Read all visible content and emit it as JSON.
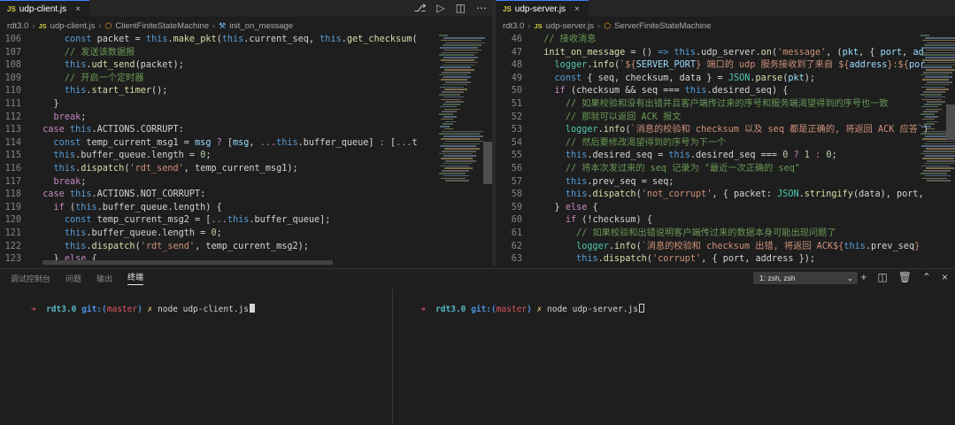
{
  "colors": {
    "keyword": "#569cd6",
    "control": "#c586c0",
    "function": "#dcdcaa",
    "variable": "#9cdcfe",
    "string": "#ce9178",
    "comment": "#6a9955",
    "number": "#b5cea8",
    "object": "#4ec9b0",
    "plain": "#d4d4d4",
    "param": "#9cdcfe"
  },
  "left_editor": {
    "tab": {
      "icon": "JS",
      "label": "udp-client.js",
      "close": "×"
    },
    "actions": [
      "source-control-icon",
      "run-icon",
      "split-editor-icon",
      "more-icon"
    ],
    "breadcrumb": {
      "folder": "rdt3.0",
      "file_icon": "JS",
      "file": "udp-client.js",
      "class": "ClientFiniteStateMachine",
      "method": "init_on_message"
    },
    "lines": [
      {
        "n": "106",
        "indent": 3,
        "tokens": [
          [
            "k",
            "const "
          ],
          [
            "p",
            "packet "
          ],
          [
            "p",
            "= "
          ],
          [
            "k",
            "this"
          ],
          [
            "p",
            "."
          ],
          [
            "f",
            "make_pkt"
          ],
          [
            "p",
            "("
          ],
          [
            "k",
            "this"
          ],
          [
            "p",
            ".current_seq, "
          ],
          [
            "k",
            "this"
          ],
          [
            "p",
            "."
          ],
          [
            "f",
            "get_checksum"
          ],
          [
            "p",
            "("
          ]
        ]
      },
      {
        "n": "107",
        "indent": 3,
        "tokens": [
          [
            "c",
            "// 发送该数据报"
          ]
        ]
      },
      {
        "n": "108",
        "indent": 3,
        "tokens": [
          [
            "k",
            "this"
          ],
          [
            "p",
            "."
          ],
          [
            "f",
            "udt_send"
          ],
          [
            "p",
            "(packet);"
          ]
        ]
      },
      {
        "n": "109",
        "indent": 3,
        "tokens": [
          [
            "c",
            "// 开启一个定时器"
          ]
        ]
      },
      {
        "n": "110",
        "indent": 3,
        "tokens": [
          [
            "k",
            "this"
          ],
          [
            "p",
            "."
          ],
          [
            "f",
            "start_timer"
          ],
          [
            "p",
            "();"
          ]
        ]
      },
      {
        "n": "111",
        "indent": 2,
        "tokens": [
          [
            "p",
            "}"
          ]
        ]
      },
      {
        "n": "112",
        "indent": 2,
        "tokens": [
          [
            "x",
            "break"
          ],
          [
            "p",
            ";"
          ]
        ]
      },
      {
        "n": "113",
        "indent": 1,
        "tokens": [
          [
            "x",
            "case "
          ],
          [
            "k",
            "this"
          ],
          [
            "p",
            ".ACTIONS.CORRUPT:"
          ]
        ]
      },
      {
        "n": "114",
        "indent": 2,
        "tokens": [
          [
            "k",
            "const "
          ],
          [
            "p",
            "temp_current_msg1 "
          ],
          [
            "p",
            "= "
          ],
          [
            "v",
            "msg "
          ],
          [
            "x",
            "? "
          ],
          [
            "p",
            "["
          ],
          [
            "v",
            "msg"
          ],
          [
            "p",
            ", "
          ],
          [
            "x",
            "..."
          ],
          [
            "k",
            "this"
          ],
          [
            "p",
            ".buffer_queue] "
          ],
          [
            "x",
            ": "
          ],
          [
            "p",
            "["
          ],
          [
            "x",
            "..."
          ],
          [
            "p",
            "t"
          ]
        ]
      },
      {
        "n": "115",
        "indent": 2,
        "tokens": [
          [
            "k",
            "this"
          ],
          [
            "p",
            ".buffer_queue.length "
          ],
          [
            "p",
            "= "
          ],
          [
            "n",
            "0"
          ],
          [
            "p",
            ";"
          ]
        ]
      },
      {
        "n": "116",
        "indent": 2,
        "tokens": [
          [
            "k",
            "this"
          ],
          [
            "p",
            "."
          ],
          [
            "f",
            "dispatch"
          ],
          [
            "p",
            "("
          ],
          [
            "s",
            "'rdt_send'"
          ],
          [
            "p",
            ", temp_current_msg1);"
          ]
        ]
      },
      {
        "n": "117",
        "indent": 2,
        "tokens": [
          [
            "x",
            "break"
          ],
          [
            "p",
            ";"
          ]
        ]
      },
      {
        "n": "118",
        "indent": 1,
        "tokens": [
          [
            "x",
            "case "
          ],
          [
            "k",
            "this"
          ],
          [
            "p",
            ".ACTIONS.NOT_CORRUPT:"
          ]
        ]
      },
      {
        "n": "119",
        "indent": 2,
        "tokens": [
          [
            "x",
            "if "
          ],
          [
            "p",
            "("
          ],
          [
            "k",
            "this"
          ],
          [
            "p",
            ".buffer_queue.length) {"
          ]
        ]
      },
      {
        "n": "120",
        "indent": 3,
        "tokens": [
          [
            "k",
            "const "
          ],
          [
            "p",
            "temp_current_msg2 "
          ],
          [
            "p",
            "= ["
          ],
          [
            "x",
            "..."
          ],
          [
            "k",
            "this"
          ],
          [
            "p",
            ".buffer_queue];"
          ]
        ]
      },
      {
        "n": "121",
        "indent": 3,
        "tokens": [
          [
            "k",
            "this"
          ],
          [
            "p",
            ".buffer_queue.length "
          ],
          [
            "p",
            "= "
          ],
          [
            "n",
            "0"
          ],
          [
            "p",
            ";"
          ]
        ]
      },
      {
        "n": "122",
        "indent": 3,
        "tokens": [
          [
            "k",
            "this"
          ],
          [
            "p",
            "."
          ],
          [
            "f",
            "dispatch"
          ],
          [
            "p",
            "("
          ],
          [
            "s",
            "'rdt_send'"
          ],
          [
            "p",
            ", temp_current_msg2);"
          ]
        ]
      },
      {
        "n": "123",
        "indent": 2,
        "tokens": [
          [
            "p",
            "} "
          ],
          [
            "x",
            "else "
          ],
          [
            "p",
            "{"
          ]
        ]
      }
    ]
  },
  "right_editor": {
    "tab": {
      "icon": "JS",
      "label": "udp-server.js",
      "close": "×"
    },
    "breadcrumb": {
      "folder": "rdt3.0",
      "file_icon": "JS",
      "file": "udp-server.js",
      "class": "ServerFiniteStateMachine"
    },
    "lines": [
      {
        "n": "46",
        "indent": 1,
        "tokens": [
          [
            "c",
            "// 接收消息"
          ]
        ]
      },
      {
        "n": "47",
        "indent": 1,
        "tokens": [
          [
            "f",
            "init_on_message "
          ],
          [
            "p",
            "= () "
          ],
          [
            "k",
            "=> "
          ],
          [
            "k",
            "this"
          ],
          [
            "p",
            ".udp_server."
          ],
          [
            "f",
            "on"
          ],
          [
            "p",
            "("
          ],
          [
            "s",
            "'message'"
          ],
          [
            "p",
            ", ("
          ],
          [
            "v",
            "pkt"
          ],
          [
            "p",
            ", { "
          ],
          [
            "v",
            "port"
          ],
          [
            "p",
            ", "
          ],
          [
            "v",
            "ad"
          ]
        ]
      },
      {
        "n": "48",
        "indent": 2,
        "tokens": [
          [
            "o",
            "logger"
          ],
          [
            "p",
            "."
          ],
          [
            "f",
            "info"
          ],
          [
            "p",
            "("
          ],
          [
            "s",
            "`${"
          ],
          [
            "v",
            "SERVER_PORT"
          ],
          [
            "s",
            "} 端口的 udp 服务接收到了来自 ${"
          ],
          [
            "v",
            "address"
          ],
          [
            "s",
            "}:${"
          ],
          [
            "v",
            "por"
          ]
        ]
      },
      {
        "n": "49",
        "indent": 2,
        "tokens": [
          [
            "k",
            "const "
          ],
          [
            "p",
            "{ seq, checksum, data } = "
          ],
          [
            "o",
            "JSON"
          ],
          [
            "p",
            "."
          ],
          [
            "f",
            "parse"
          ],
          [
            "p",
            "("
          ],
          [
            "v",
            "pkt"
          ],
          [
            "p",
            ");"
          ]
        ]
      },
      {
        "n": "50",
        "indent": 2,
        "tokens": [
          [
            "x",
            "if "
          ],
          [
            "p",
            "(checksum "
          ],
          [
            "p",
            "&& "
          ],
          [
            "p",
            "seq "
          ],
          [
            "p",
            "=== "
          ],
          [
            "k",
            "this"
          ],
          [
            "p",
            ".desired_seq) {"
          ]
        ]
      },
      {
        "n": "51",
        "indent": 3,
        "tokens": [
          [
            "c",
            "// 如果校验和没有出错并且客户端传过来的序号和服务端渴望得到的序号也一致"
          ]
        ]
      },
      {
        "n": "52",
        "indent": 3,
        "tokens": [
          [
            "c",
            "// 那就可以返回 ACK 报文"
          ]
        ]
      },
      {
        "n": "53",
        "indent": 3,
        "tokens": [
          [
            "o",
            "logger"
          ],
          [
            "p",
            "."
          ],
          [
            "f",
            "info"
          ],
          [
            "p",
            "("
          ],
          [
            "s",
            "`消息的校验和 checksum 以及 seq 都是正确的, 将返回 ACK 应答`"
          ],
          [
            "p",
            ")"
          ]
        ]
      },
      {
        "n": "54",
        "indent": 3,
        "tokens": [
          [
            "c",
            "// 然后要修改渴望得到的序号为下一个"
          ]
        ]
      },
      {
        "n": "55",
        "indent": 3,
        "tokens": [
          [
            "k",
            "this"
          ],
          [
            "p",
            ".desired_seq "
          ],
          [
            "p",
            "= "
          ],
          [
            "k",
            "this"
          ],
          [
            "p",
            ".desired_seq "
          ],
          [
            "p",
            "=== "
          ],
          [
            "n",
            "0 "
          ],
          [
            "x",
            "? "
          ],
          [
            "n",
            "1 "
          ],
          [
            "x",
            ": "
          ],
          [
            "n",
            "0"
          ],
          [
            "p",
            ";"
          ]
        ]
      },
      {
        "n": "56",
        "indent": 3,
        "tokens": [
          [
            "c",
            "// 将本次发过来的 seq 记录为 \"最近一次正确的 seq\""
          ]
        ]
      },
      {
        "n": "57",
        "indent": 3,
        "tokens": [
          [
            "k",
            "this"
          ],
          [
            "p",
            ".prev_seq "
          ],
          [
            "p",
            "= seq;"
          ]
        ]
      },
      {
        "n": "58",
        "indent": 3,
        "tokens": [
          [
            "k",
            "this"
          ],
          [
            "p",
            "."
          ],
          [
            "f",
            "dispatch"
          ],
          [
            "p",
            "("
          ],
          [
            "s",
            "'not_corrupt'"
          ],
          [
            "p",
            ", { packet: "
          ],
          [
            "o",
            "JSON"
          ],
          [
            "p",
            "."
          ],
          [
            "f",
            "stringify"
          ],
          [
            "p",
            "(data), port, "
          ]
        ]
      },
      {
        "n": "59",
        "indent": 2,
        "tokens": [
          [
            "p",
            "} "
          ],
          [
            "x",
            "else "
          ],
          [
            "p",
            "{"
          ]
        ]
      },
      {
        "n": "60",
        "indent": 3,
        "tokens": [
          [
            "x",
            "if "
          ],
          [
            "p",
            "(!checksum) {"
          ]
        ]
      },
      {
        "n": "61",
        "indent": 4,
        "tokens": [
          [
            "c",
            "// 如果校验和出错说明客户端传过来的数据本身可能出现问题了"
          ]
        ]
      },
      {
        "n": "62",
        "indent": 4,
        "tokens": [
          [
            "o",
            "logger"
          ],
          [
            "p",
            "."
          ],
          [
            "f",
            "info"
          ],
          [
            "p",
            "("
          ],
          [
            "s",
            "`消息的校验和 checksum 出错, 将返回 ACK${"
          ],
          [
            "k",
            "this"
          ],
          [
            "p",
            ".prev_seq"
          ],
          [
            "s",
            "}"
          ]
        ]
      },
      {
        "n": "63",
        "indent": 4,
        "tokens": [
          [
            "k",
            "this"
          ],
          [
            "p",
            "."
          ],
          [
            "f",
            "dispatch"
          ],
          [
            "p",
            "("
          ],
          [
            "s",
            "'corrupt'"
          ],
          [
            "p",
            ", { port, address });"
          ]
        ]
      }
    ]
  },
  "panel": {
    "tabs": [
      "调试控制台",
      "问题",
      "输出",
      "终端"
    ],
    "active_tab": "终端",
    "terminal_select": "1: zsh, zsh",
    "actions": [
      "add-terminal-icon",
      "split-terminal-icon",
      "trash-icon",
      "maximize-icon",
      "close-icon"
    ],
    "terminals": [
      {
        "arrow": "➜",
        "dir": "rdt3.0",
        "git": "git:(",
        "branch": "master",
        "git_close": ")",
        "x": "✗",
        "cmd": "node udp-client.js"
      },
      {
        "arrow": "➜",
        "dir": "rdt3.0",
        "git": "git:(",
        "branch": "master",
        "git_close": ")",
        "x": "✗",
        "cmd": "node udp-server.js"
      }
    ]
  }
}
